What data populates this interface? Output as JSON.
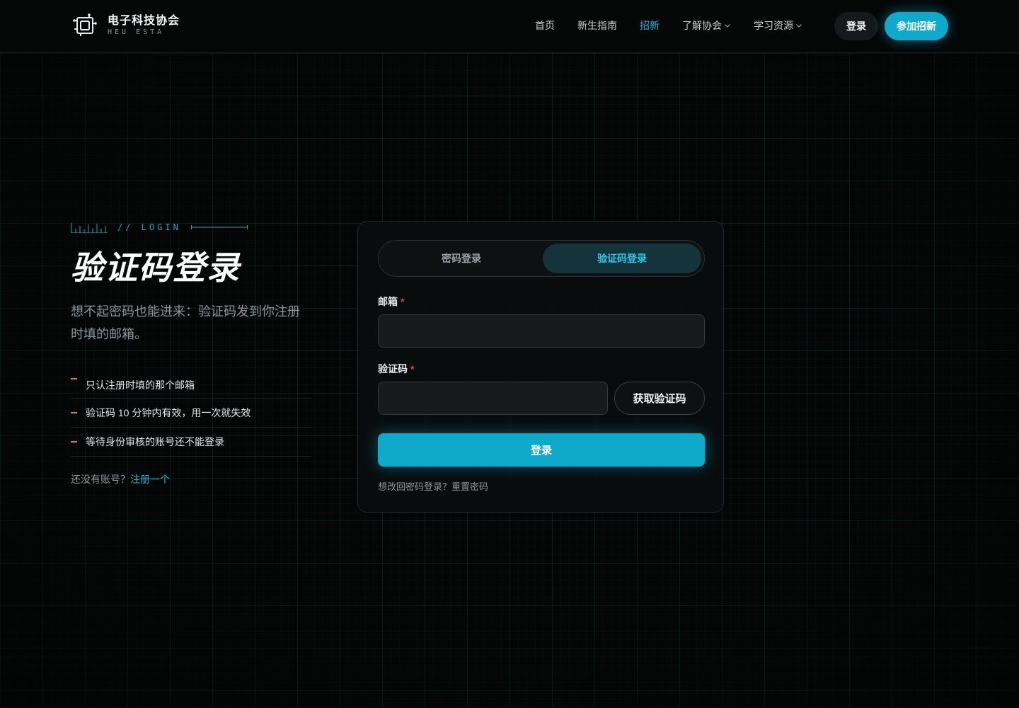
{
  "colors": {
    "accent": "#0fa9cc",
    "accent_text": "#22b8d9",
    "required_mark": "#e0463a",
    "tip_dash": "#e07b3a",
    "background": "#050707"
  },
  "header": {
    "brand_name": "电子科技协会",
    "brand_sub": "HEU ESTA",
    "logo_icon": "circuit-logo-icon",
    "nav": [
      {
        "label": "首页",
        "active": false,
        "dropdown": false
      },
      {
        "label": "新生指南",
        "active": false,
        "dropdown": false
      },
      {
        "label": "招新",
        "active": true,
        "dropdown": false
      },
      {
        "label": "了解协会",
        "active": false,
        "dropdown": true
      },
      {
        "label": "学习资源",
        "active": false,
        "dropdown": true
      }
    ],
    "login_label": "登录",
    "join_label": "参加招新"
  },
  "intro": {
    "kicker": "// LOGIN",
    "title": "验证码登录",
    "subtitle": "想不起密码也能进来：验证码发到你注册时填的邮箱。",
    "tips": [
      "只认注册时填的那个邮箱",
      "验证码 10 分钟内有效，用一次就失效",
      "等待身份审核的账号还不能登录"
    ],
    "register_prompt": "还没有账号？",
    "register_link": "注册一个"
  },
  "form": {
    "tabs": [
      {
        "label": "密码登录",
        "active": false
      },
      {
        "label": "验证码登录",
        "active": true
      }
    ],
    "email_label": "邮箱",
    "email_value": "",
    "code_label": "验证码",
    "code_value": "",
    "required_mark": "*",
    "get_code_label": "获取验证码",
    "submit_label": "登录",
    "switch_prompt": "想改回密码登录？",
    "reset_link": "重置密码"
  }
}
